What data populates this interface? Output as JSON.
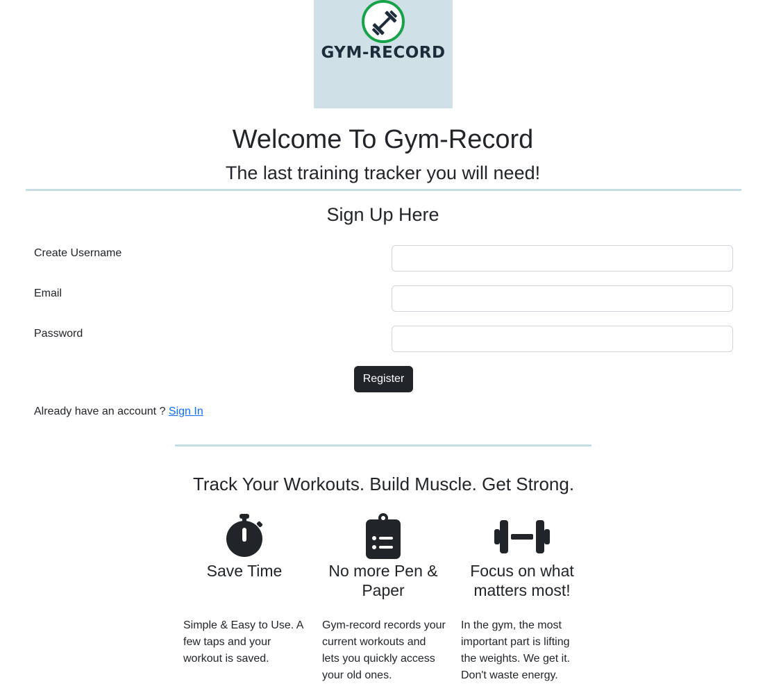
{
  "logo": {
    "text": "GYM-RECORD",
    "ring_color": "#17a34a",
    "bg_color": "#d0e0e7"
  },
  "welcome": "Welcome To Gym-Record",
  "tagline": "The last training tracker you will need!",
  "signup": {
    "title": "Sign Up Here",
    "username_label": "Create Username",
    "username_value": "",
    "email_label": "Email",
    "email_value": "",
    "password_label": "Password",
    "password_value": "",
    "register_label": "Register"
  },
  "signin": {
    "prompt": "Already have an account ?",
    "link_label": "Sign In"
  },
  "track_heading": "Track Your Workouts. Build Muscle. Get Strong.",
  "features": [
    {
      "icon": "stopwatch-icon",
      "title": "Save Time",
      "text": "Simple & Easy to Use. A few taps and your workout is saved."
    },
    {
      "icon": "clipboard-list-icon",
      "title": "No more Pen & Paper",
      "text": "Gym-record records your current workouts and lets you quickly access your old ones."
    },
    {
      "icon": "dumbbell-icon",
      "title": "Focus on what matters most!",
      "text": "In the gym, the most important part is lifting the weights. We get it. Don't waste energy."
    }
  ],
  "colors": {
    "text": "#212529",
    "button": "#212529",
    "link": "#0d6efd",
    "rule": "#c6dde3"
  }
}
